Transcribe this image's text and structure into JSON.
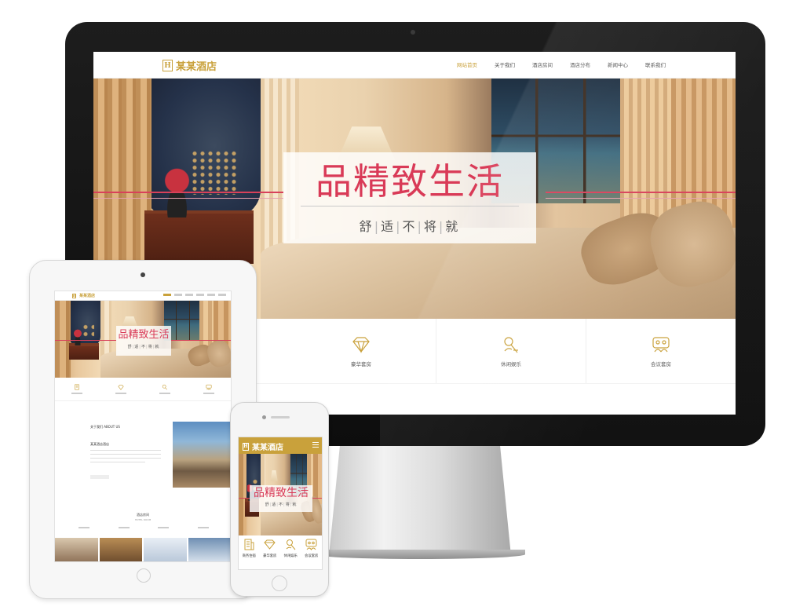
{
  "brand": {
    "name": "某某酒店",
    "mark": "H",
    "accent_color": "#c9a13b",
    "hero_text_color": "#d93a57"
  },
  "nav": {
    "items": [
      {
        "label": "网站首页",
        "active": true
      },
      {
        "label": "关于我们",
        "active": false
      },
      {
        "label": "酒店房间",
        "active": false
      },
      {
        "label": "酒店分布",
        "active": false
      },
      {
        "label": "新闻中心",
        "active": false
      },
      {
        "label": "联系我们",
        "active": false
      }
    ]
  },
  "hero": {
    "title": "品精致生活",
    "subtitle": [
      "舒",
      "适",
      "不",
      "将",
      "就"
    ]
  },
  "features": [
    {
      "label": "豪华套房",
      "icon": "diamond-icon"
    },
    {
      "label": "休闲娱乐",
      "icon": "leisure-icon"
    },
    {
      "label": "会议套房",
      "icon": "meeting-icon"
    }
  ],
  "mobile_features": [
    {
      "label": "商务住宿",
      "icon": "business-icon"
    },
    {
      "label": "豪华套房",
      "icon": "diamond-icon"
    },
    {
      "label": "休闲娱乐",
      "icon": "leisure-icon"
    },
    {
      "label": "会议套房",
      "icon": "meeting-icon"
    }
  ],
  "tablet": {
    "about_title": "关于我们 ABOUT US",
    "about_subtitle": "某某酒店酒店",
    "rooms_title": "酒店房间",
    "rooms_subtitle": "HOTEL ROOM"
  }
}
